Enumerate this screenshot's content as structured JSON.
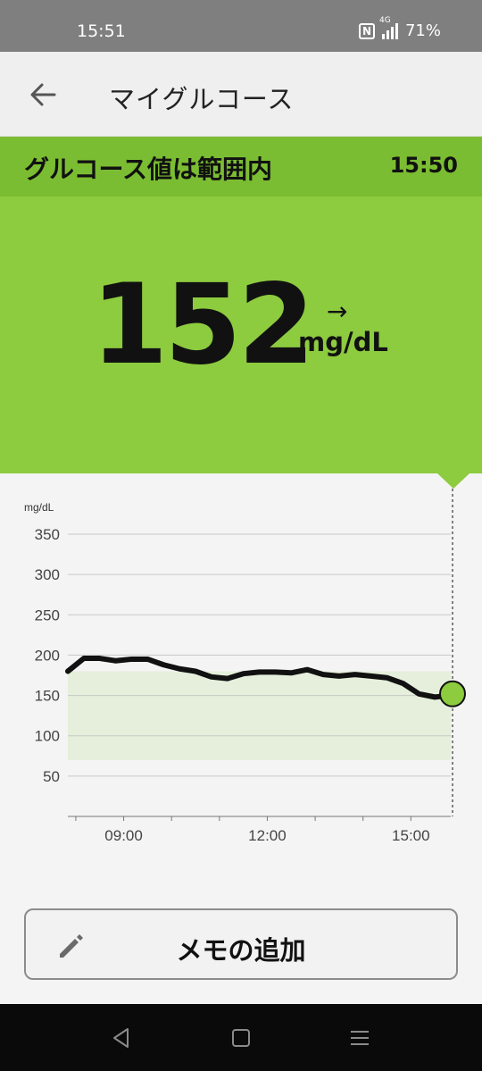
{
  "status_bar": {
    "time": "15:51",
    "battery": "71%",
    "network": "4G",
    "nfc_label": "N"
  },
  "app_bar": {
    "title": "マイグルコース"
  },
  "range_banner": {
    "text": "グルコース値は範囲内",
    "time": "15:50"
  },
  "reading": {
    "value": "152",
    "unit": "mg/dL",
    "trend_arrow": "→"
  },
  "chart_data": {
    "type": "line",
    "ylabel": "mg/dL",
    "yticks": [
      350,
      300,
      250,
      200,
      150,
      100,
      50
    ],
    "ylim": [
      0,
      350
    ],
    "xticks": [
      "09:00",
      "12:00",
      "15:00"
    ],
    "xlim": [
      "07:50",
      "15:50"
    ],
    "target_range": [
      70,
      180
    ],
    "grid": true,
    "series": [
      {
        "color": "#111111",
        "x": [
          "07:50",
          "08:10",
          "08:30",
          "08:50",
          "09:10",
          "09:30",
          "09:50",
          "10:10",
          "10:30",
          "10:50",
          "11:10",
          "11:30",
          "11:50",
          "12:10",
          "12:30",
          "12:50",
          "13:10",
          "13:30",
          "13:50",
          "14:10",
          "14:30",
          "14:50",
          "15:10",
          "15:30",
          "15:50"
        ],
        "values": [
          180,
          196,
          196,
          193,
          195,
          195,
          188,
          183,
          180,
          173,
          171,
          177,
          179,
          179,
          178,
          182,
          176,
          174,
          176,
          174,
          172,
          165,
          152,
          148,
          150
        ]
      }
    ],
    "current": {
      "x": "15:50",
      "value": 152,
      "color": "#8dcb3f"
    }
  },
  "memo_button": {
    "label": "メモの追加"
  },
  "nav": {
    "back": "back-nav",
    "home": "home-nav",
    "recents": "recents-nav"
  }
}
